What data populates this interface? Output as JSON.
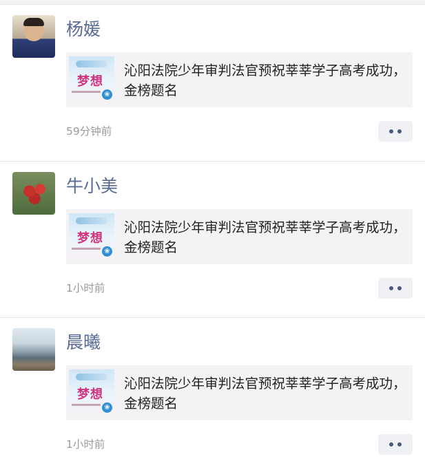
{
  "feed": {
    "posts": [
      {
        "author": "杨媛",
        "avatar": "avatar-child",
        "share": {
          "title": "沁阳法院少年审判法官预祝莘莘学子高考成功， 金榜题名",
          "thumb_text": "梦想"
        },
        "time": "59分钟前"
      },
      {
        "author": "牛小美",
        "avatar": "avatar-strawberries",
        "share": {
          "title": "沁阳法院少年审判法官预祝莘莘学子高考成功， 金榜题名",
          "thumb_text": "梦想"
        },
        "time": "1小时前"
      },
      {
        "author": "晨曦",
        "avatar": "avatar-landscape",
        "share": {
          "title": "沁阳法院少年审判法官预祝莘莘学子高考成功， 金榜题名",
          "thumb_text": "梦想"
        },
        "time": "1小时前"
      }
    ]
  },
  "colors": {
    "name": "#576b95",
    "card_bg": "#f3f3f5",
    "time": "#9a9a9a"
  },
  "icons": {
    "more": "more-dots-icon",
    "mini_program": "mini-program-icon"
  }
}
